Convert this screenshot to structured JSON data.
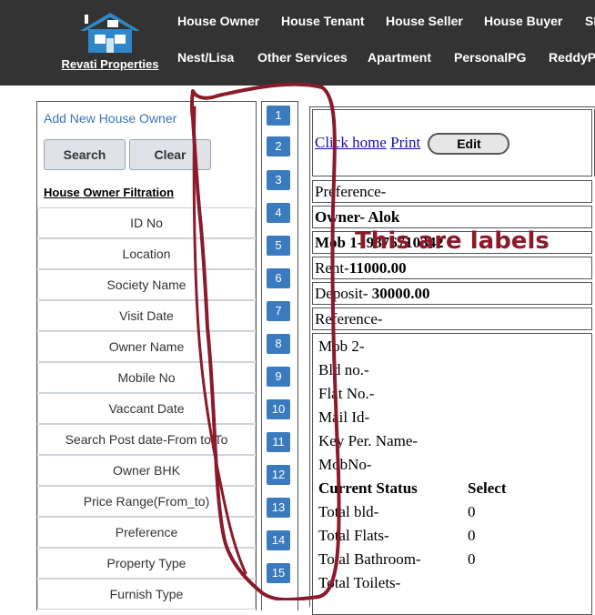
{
  "header": {
    "logo_text": "Revati Properties",
    "nav_row1": [
      "House Owner",
      "House Tenant",
      "House Seller",
      "House Buyer",
      "SI"
    ],
    "nav_row2": [
      "Nest/Lisa",
      "Other Services",
      "Apartment",
      "PersonalPG",
      "ReddyP("
    ]
  },
  "sidebar": {
    "add_link": "Add New House Owner",
    "search_label": "Search",
    "clear_label": "Clear",
    "filter_title": "House Owner Filtration",
    "filters": [
      "ID No",
      "Location",
      "Society Name",
      "Visit Date",
      "Owner Name",
      "Mobile No",
      "Vaccant Date",
      "Search Post date-From to To",
      "Owner BHK",
      "Price Range(From_to)",
      "Preference",
      "Property Type",
      "Furnish Type"
    ]
  },
  "pagination": [
    "1",
    "2",
    "3",
    "4",
    "5",
    "6",
    "7",
    "8",
    "9",
    "10",
    "11",
    "12",
    "13",
    "14",
    "15"
  ],
  "record": {
    "click_home": "Click home",
    "print": "Print",
    "edit": "Edit",
    "preference": "Preference-",
    "owner_label": "Owner-",
    "owner_value": "Alok",
    "mob_label": "Mob 1-",
    "mob_value": "9876710342",
    "rent_label": "Rent-",
    "rent_value": "11000.00",
    "deposit_label": "Deposit-",
    "deposit_value": "30000.00",
    "reference": "Reference-",
    "details": [
      "Mob 2-",
      "Bld no.-",
      "Flat No.-",
      "Mail Id-",
      "Key Per. Name-",
      "MobNo-"
    ],
    "status_label": "Current Status",
    "status_value": "Select",
    "totals": [
      {
        "label": "Total bld-",
        "value": "0"
      },
      {
        "label": "Total Flats-",
        "value": "0"
      },
      {
        "label": "Total Bathroom-",
        "value": "0"
      },
      {
        "label": "Total Toilets-",
        "value": ""
      }
    ]
  },
  "annotation": {
    "text": "This are labels",
    "color": "#8b1a2b"
  },
  "colors": {
    "header_bg": "#333333",
    "page_button": "#3a7bc0",
    "link": "#3b73b9"
  }
}
